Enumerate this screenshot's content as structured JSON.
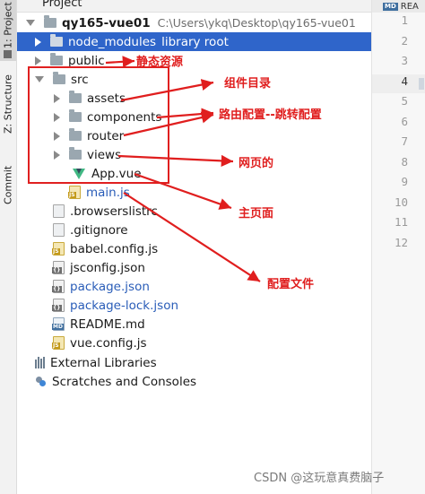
{
  "side_tabs": {
    "project": "1: Project",
    "structure": "Z: Structure",
    "commit": "Commit"
  },
  "header_title": "Project",
  "tree": {
    "root": {
      "name": "qy165-vue01",
      "path": "C:\\Users\\ykq\\Desktop\\qy165-vue01"
    },
    "node_modules": {
      "name": "node_modules",
      "note": "library root"
    },
    "public": "public",
    "src": "src",
    "assets": "assets",
    "components": "components",
    "router": "router",
    "views": "views",
    "app_vue": "App.vue",
    "main_js": "main.js",
    "browserslistrc": ".browserslistrc",
    "gitignore": ".gitignore",
    "babel_config": "babel.config.js",
    "jsconfig": "jsconfig.json",
    "package_json": "package.json",
    "package_lock": "package-lock.json",
    "readme": "README.md",
    "vue_config": "vue.config.js",
    "external_libraries": "External Libraries",
    "scratches": "Scratches and Consoles"
  },
  "editor": {
    "tab_label": "REA",
    "tab_badge": "MD",
    "line_numbers": [
      "1",
      "2",
      "3",
      "4",
      "5",
      "6",
      "7",
      "8",
      "9",
      "10",
      "11",
      "12"
    ],
    "current_line": 4
  },
  "annotations": {
    "static_resources": "静态资源",
    "component_dir": "组件目录",
    "router_config": "路由配置--跳转配置",
    "web_pages": "网页的",
    "main_page": "主页面",
    "config_files": "配置文件"
  },
  "watermark": "CSDN @这玩意真费脑子",
  "colors": {
    "selection": "#2f65ca",
    "annotation_red": "#e01e1e",
    "vue_green": "#41b883",
    "modified_blue": "#2a5db8"
  },
  "icons": {
    "folder": "folder-icon",
    "expand_closed": "chevron-right-icon",
    "expand_open": "chevron-down-icon",
    "vue_file": "vue-file-icon",
    "js_file": "js-file-icon",
    "json_file": "json-file-icon",
    "md_file": "markdown-file-icon",
    "generic_file": "text-file-icon",
    "libraries": "external-libraries-icon",
    "scratches": "scratches-icon"
  }
}
